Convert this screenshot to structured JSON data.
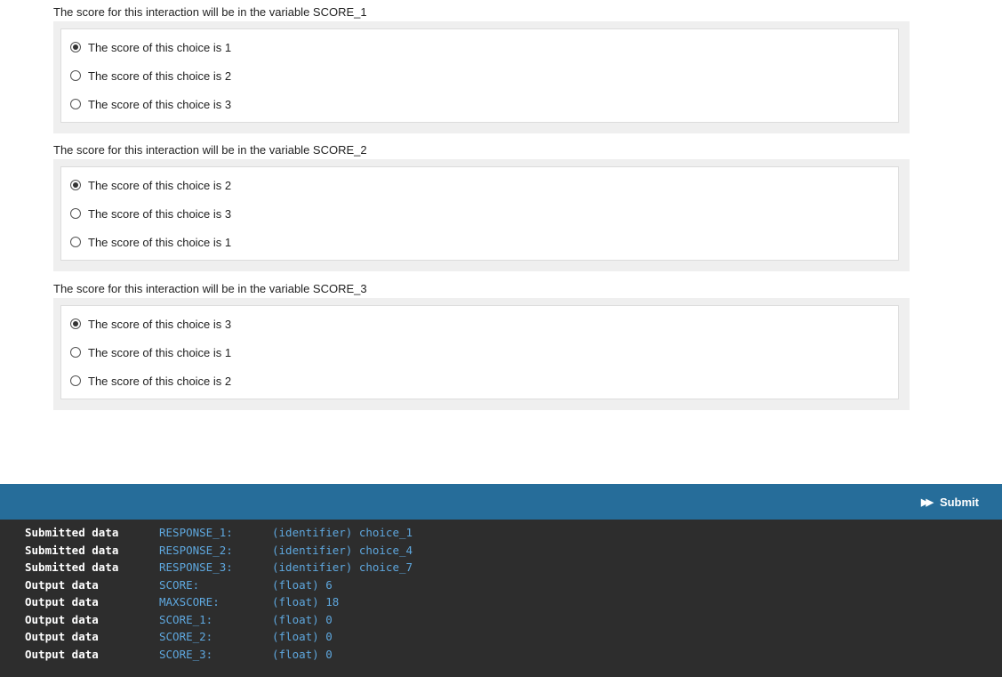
{
  "interactions": [
    {
      "prompt": "The score for this interaction will be in the variable SCORE_1",
      "choices": [
        {
          "label": "The score of this choice is 1",
          "selected": true
        },
        {
          "label": "The score of this choice is 2",
          "selected": false
        },
        {
          "label": "The score of this choice is 3",
          "selected": false
        }
      ]
    },
    {
      "prompt": "The score for this interaction will be in the variable SCORE_2",
      "choices": [
        {
          "label": "The score of this choice is 2",
          "selected": true
        },
        {
          "label": "The score of this choice is 3",
          "selected": false
        },
        {
          "label": "The score of this choice is 1",
          "selected": false
        }
      ]
    },
    {
      "prompt": "The score for this interaction will be in the variable SCORE_3",
      "choices": [
        {
          "label": "The score of this choice is 3",
          "selected": true
        },
        {
          "label": "The score of this choice is 1",
          "selected": false
        },
        {
          "label": "The score of this choice is 2",
          "selected": false
        }
      ]
    }
  ],
  "toolbar": {
    "submit_label": "Submit",
    "submit_icon": "fast-forward-icon",
    "background": "#266d9a"
  },
  "console": {
    "background": "#2d2d2d",
    "rows": [
      {
        "type": "Submitted data",
        "variable": "RESPONSE_1:",
        "value": "(identifier) choice_1"
      },
      {
        "type": "Submitted data",
        "variable": "RESPONSE_2:",
        "value": "(identifier) choice_4"
      },
      {
        "type": "Submitted data",
        "variable": "RESPONSE_3:",
        "value": "(identifier) choice_7"
      },
      {
        "type": "Output data",
        "variable": "SCORE:",
        "value": "(float) 6"
      },
      {
        "type": "Output data",
        "variable": "MAXSCORE:",
        "value": "(float) 18"
      },
      {
        "type": "Output data",
        "variable": "SCORE_1:",
        "value": "(float) 0"
      },
      {
        "type": "Output data",
        "variable": "SCORE_2:",
        "value": "(float) 0"
      },
      {
        "type": "Output data",
        "variable": "SCORE_3:",
        "value": "(float) 0"
      }
    ]
  }
}
